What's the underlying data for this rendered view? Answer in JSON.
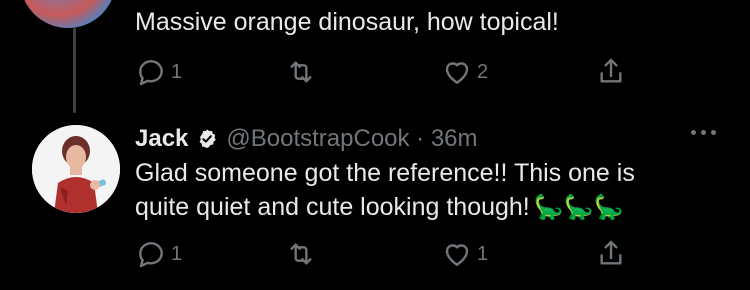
{
  "parent_tweet": {
    "text": "Massive orange dinosaur, how topical!",
    "reply_count": "1",
    "retweet_count": "",
    "like_count": "2"
  },
  "reply_tweet": {
    "author_name": "Jack",
    "handle_time": "@BootstrapCook · 36m",
    "text_line1": "Glad someone got the reference!! This one is",
    "text_line2": "quite quiet and cute looking though!",
    "emojis": "🦕🦕🦕",
    "reply_count": "1",
    "retweet_count": "",
    "like_count": "1"
  },
  "icons": {
    "reply": "reply-icon",
    "retweet": "retweet-icon",
    "like": "heart-icon",
    "share": "share-icon",
    "verified": "verified-badge-icon",
    "more": "more-options-icon"
  },
  "colors": {
    "background": "#000000",
    "text": "#e7e9ea",
    "secondary": "#71767b",
    "verified_badge": "#e7e9ea"
  }
}
